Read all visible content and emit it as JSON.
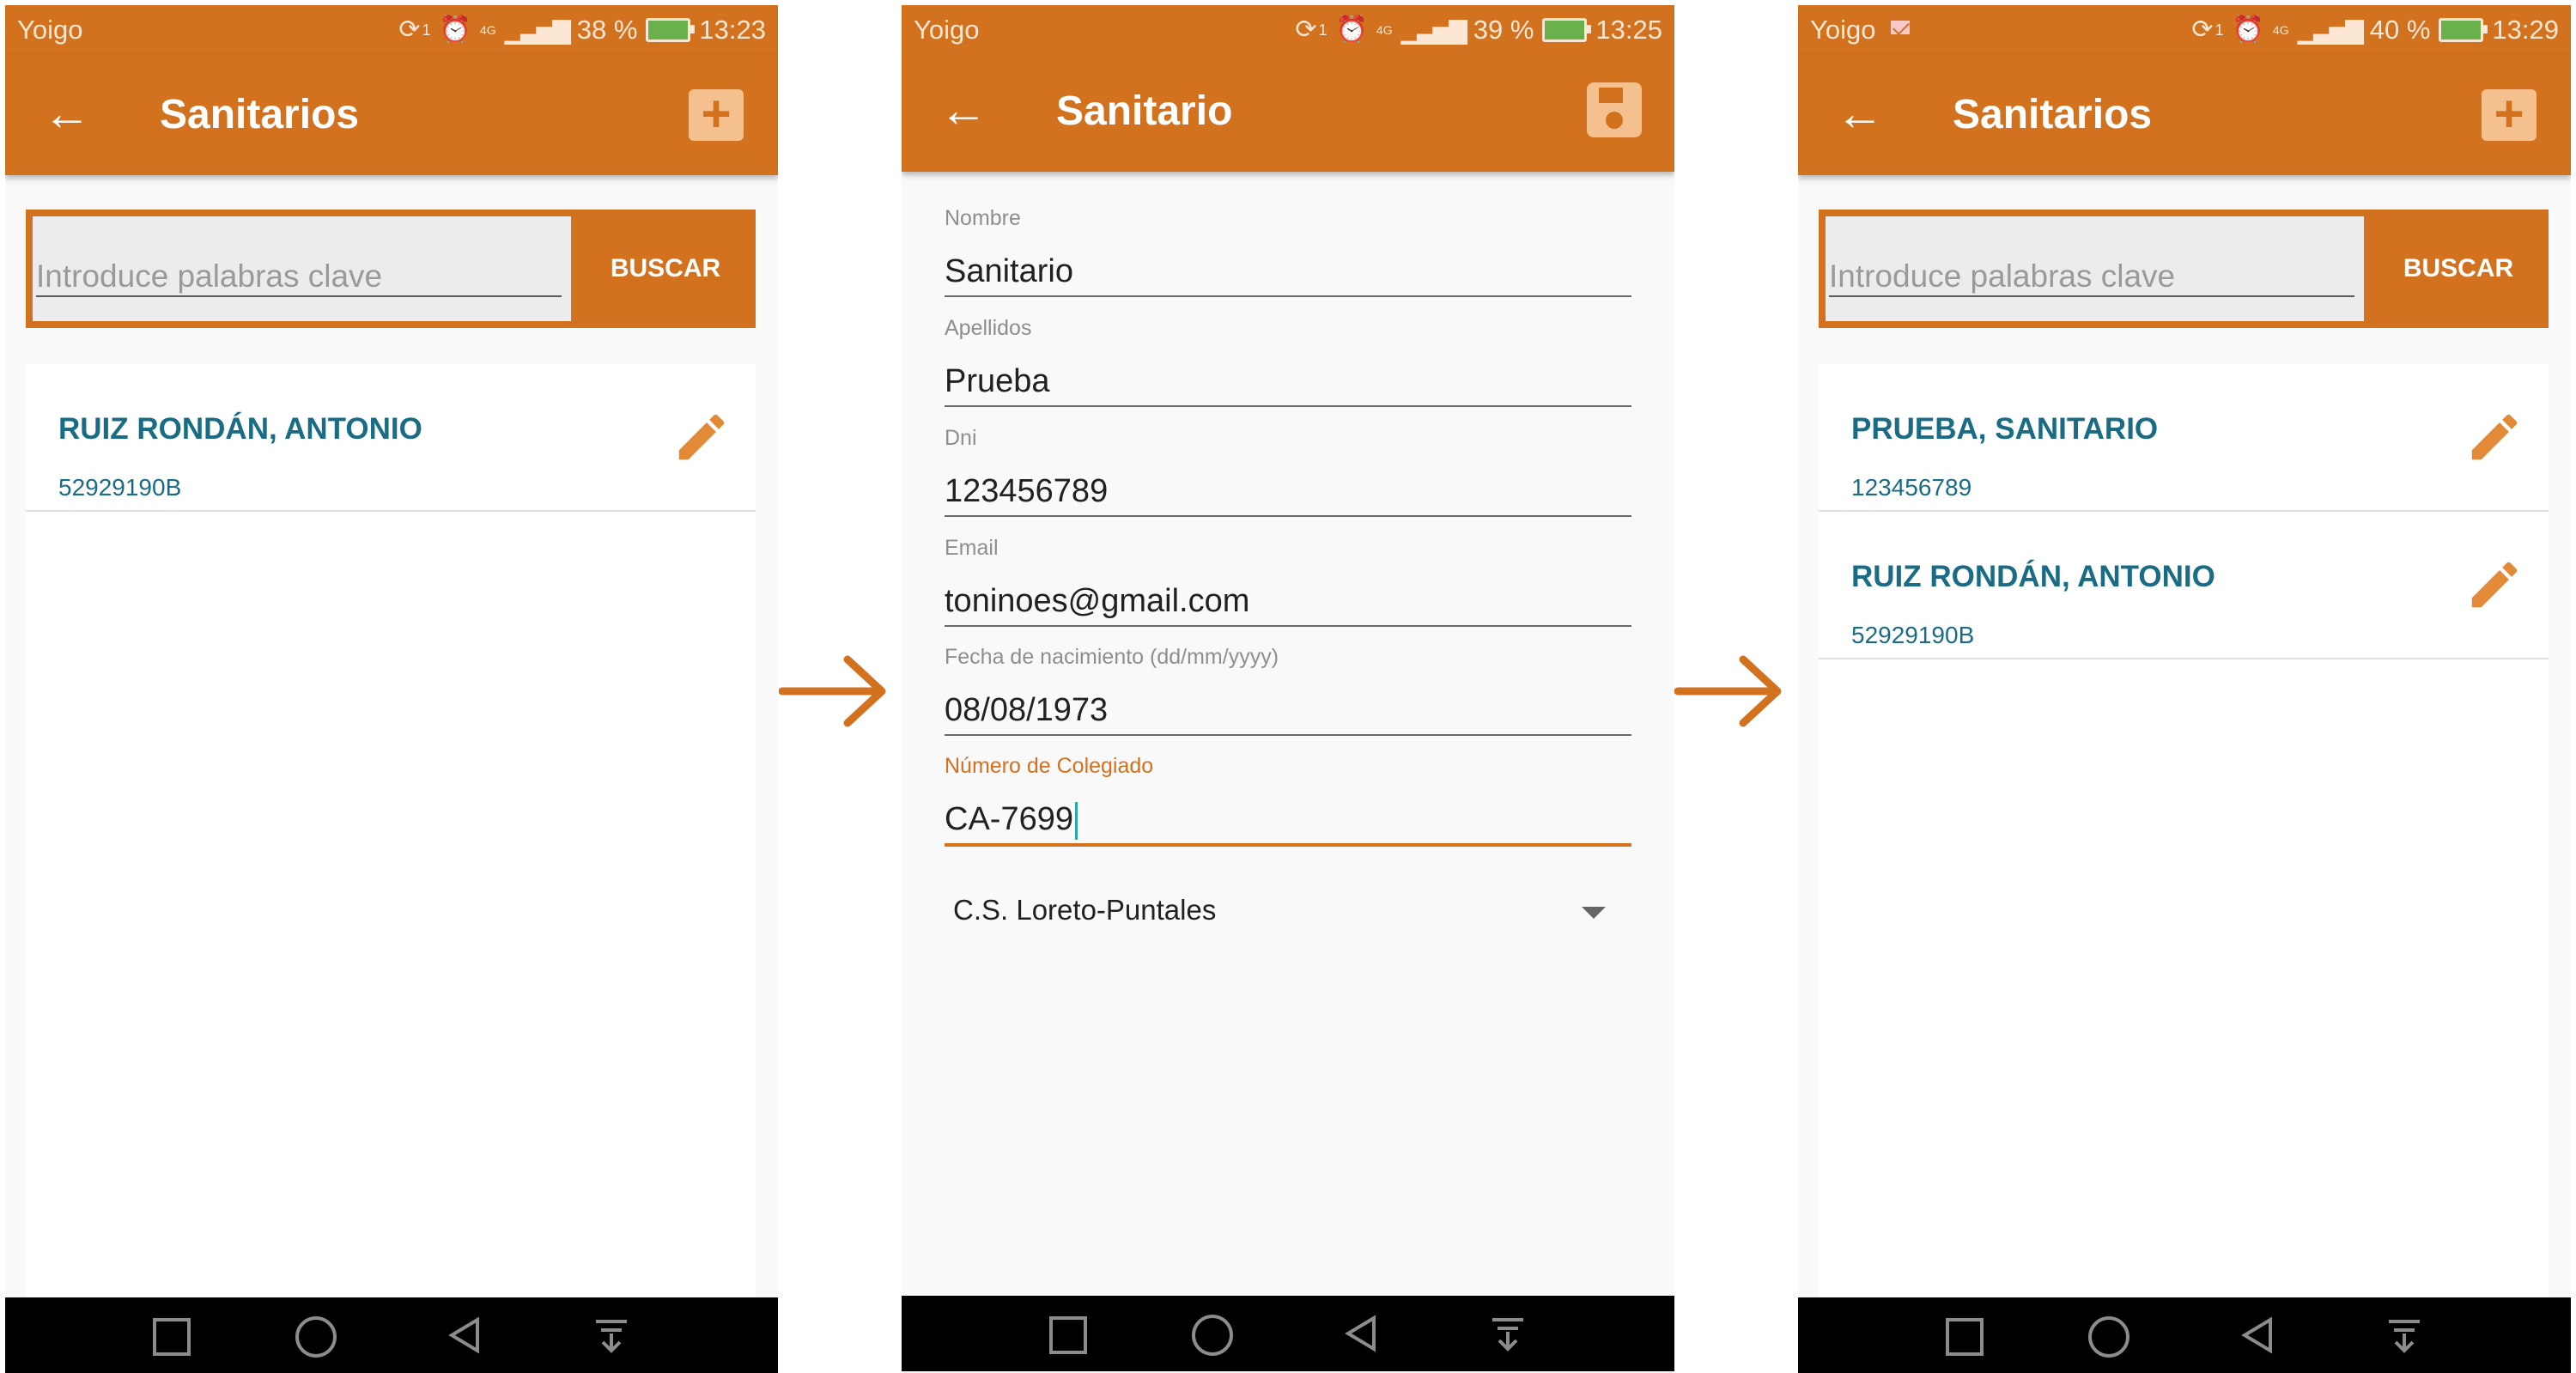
{
  "colors": {
    "brand": "#d2711e",
    "name_text": "#1a6c85",
    "nav_bg": "#000000",
    "list_bg": "#ffffff"
  },
  "screens": [
    {
      "status": {
        "carrier": "Yoigo",
        "notif_count": "1",
        "net": "4G",
        "battery": "38 %",
        "time": "13:23"
      },
      "appbar": {
        "title": "Sanitarios",
        "back_icon": "arrow-left-icon",
        "action_icon": "plus-icon"
      },
      "search": {
        "placeholder": "Introduce palabras clave",
        "button": "BUSCAR"
      },
      "list": [
        {
          "name": "RUIZ RONDÁN, ANTONIO",
          "dni": "52929190B",
          "icon": "pencil-icon"
        }
      ]
    },
    {
      "status": {
        "carrier": "Yoigo",
        "notif_count": "1",
        "net": "4G",
        "battery": "39 %",
        "time": "13:25"
      },
      "appbar": {
        "title": "Sanitario",
        "back_icon": "arrow-left-icon",
        "action_icon": "save-icon"
      },
      "form": {
        "nombre_label": "Nombre",
        "nombre": "Sanitario",
        "apellidos_label": "Apellidos",
        "apellidos": "Prueba",
        "dni_label": "Dni",
        "dni": "123456789",
        "email_label": "Email",
        "email": "toninoes@gmail.com",
        "fecha_label": "Fecha de nacimiento (dd/mm/yyyy)",
        "fecha": "08/08/1973",
        "colegiado_label": "Número de Colegiado",
        "colegiado": "CA-7699",
        "centro": "C.S. Loreto-Puntales"
      }
    },
    {
      "status": {
        "carrier": "Yoigo",
        "notif_count": "1",
        "net": "4G",
        "battery": "40 %",
        "time": "13:29"
      },
      "appbar": {
        "title": "Sanitarios",
        "back_icon": "arrow-left-icon",
        "action_icon": "plus-icon"
      },
      "search": {
        "placeholder": "Introduce palabras clave",
        "button": "BUSCAR"
      },
      "list": [
        {
          "name": "PRUEBA, SANITARIO",
          "dni": "123456789",
          "icon": "pencil-icon"
        },
        {
          "name": "RUIZ RONDÁN, ANTONIO",
          "dni": "52929190B",
          "icon": "pencil-icon"
        }
      ]
    }
  ],
  "navbar": {
    "icons": [
      "square-icon",
      "circle-icon",
      "triangle-back-icon",
      "notification-drawer-icon"
    ]
  }
}
